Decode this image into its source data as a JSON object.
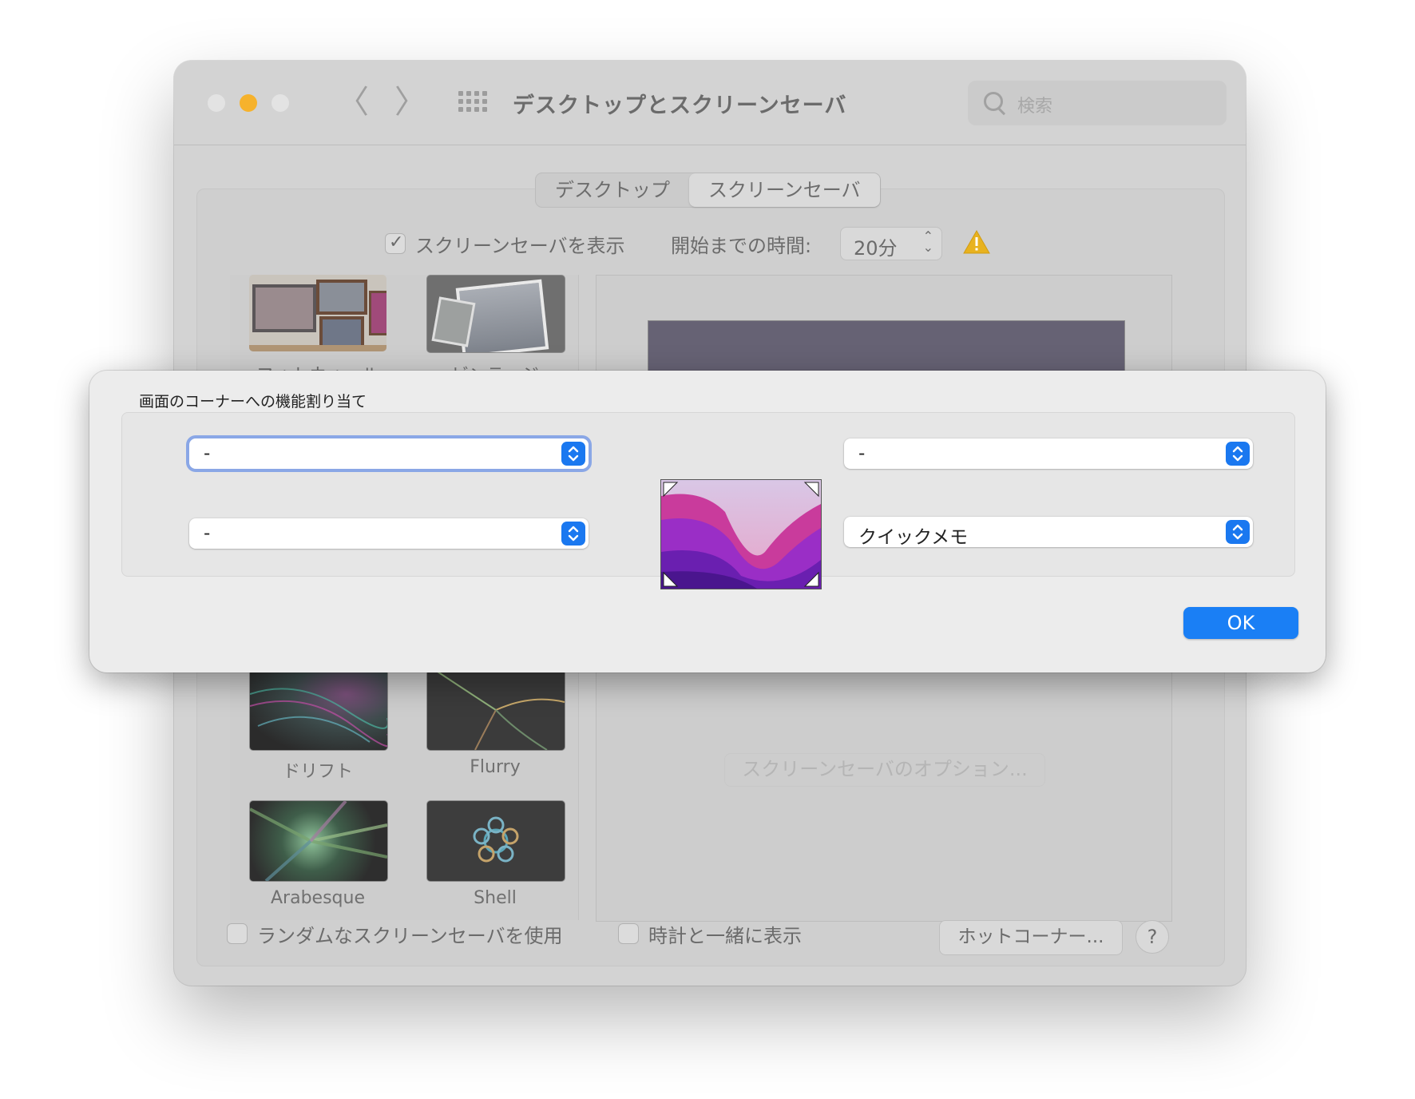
{
  "window": {
    "title": "デスクトップとスクリーンセーバ",
    "search_placeholder": "検索",
    "nav_back": "〈",
    "nav_forward": "〉"
  },
  "tabs": [
    {
      "label": "デスクトップ",
      "active": false
    },
    {
      "label": "スクリーンセーバ",
      "active": true
    }
  ],
  "options": {
    "show_screensaver_label": "スクリーンセーバを表示",
    "show_screensaver_checked": true,
    "start_after_label": "開始までの時間:",
    "start_after_value": "20分"
  },
  "screensavers": [
    {
      "name": "フォトウォール"
    },
    {
      "name": "ビンテージ"
    },
    {
      "name": "ドリフト"
    },
    {
      "name": "Flurry"
    },
    {
      "name": "Arabesque"
    },
    {
      "name": "Shell"
    }
  ],
  "screensaver_options_button": "スクリーンセーバのオプション...",
  "bottom": {
    "random_label": "ランダムなスクリーンセーバを使用",
    "clock_label": "時計と一緒に表示",
    "hot_corners_button": "ホットコーナー...",
    "help_button": "?"
  },
  "sheet": {
    "title": "画面のコーナーへの機能割り当て",
    "top_left": "-",
    "bottom_left": "-",
    "top_right": "-",
    "bottom_right": "クイックメモ",
    "ok_button": "OK"
  },
  "colors": {
    "accent": "#1a7ff5",
    "traffic_minimize": "#f6b22c",
    "warning": "#e8b21f"
  }
}
